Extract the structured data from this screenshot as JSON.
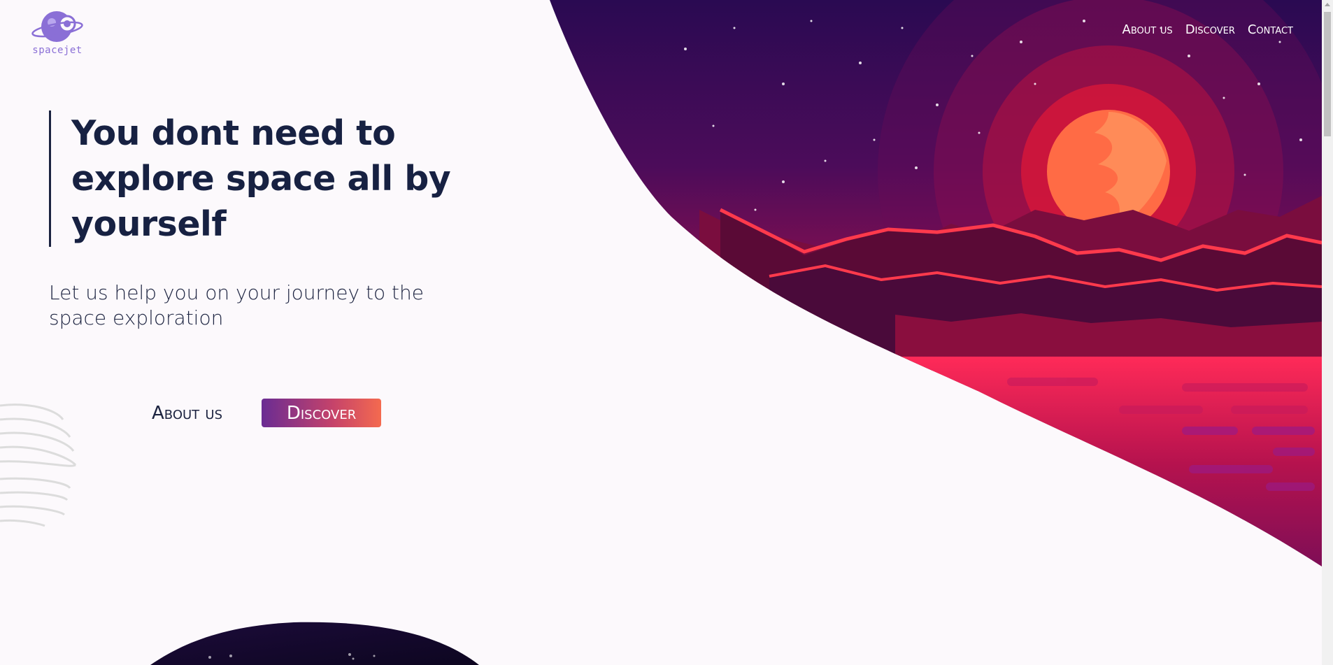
{
  "brand": {
    "logo_text": "spacejet",
    "accent_color": "#8a6fd6"
  },
  "nav": {
    "items": [
      "About us",
      "Discover",
      "Contact"
    ]
  },
  "hero": {
    "headline_lines": [
      "You dont need to",
      "explore space all by",
      "yourself"
    ],
    "subtext": "Let us help you on your journey to the space exploration",
    "about_label": "About us",
    "discover_label": "Discover"
  },
  "colors": {
    "text_dark": "#172142",
    "sky_top": "#2a0a52",
    "sky_mid": "#7d0d4f",
    "sun": "#ff6b45",
    "mountains": "#5a0a36",
    "mountain_highlight": "#ff3a4c",
    "button_gradient": [
      "#6a2c93",
      "#f46a4f"
    ]
  },
  "icons": {
    "logo": "planet-astronaut-icon",
    "scroll_up": "chevron-up-icon"
  }
}
